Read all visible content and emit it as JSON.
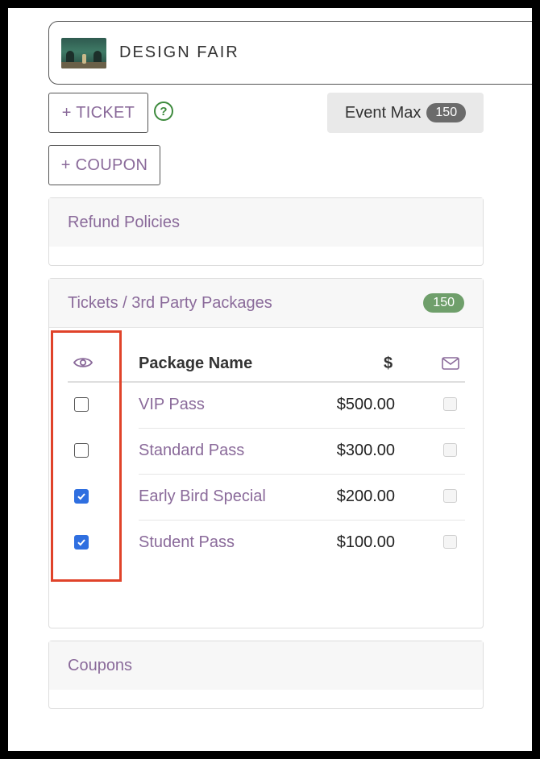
{
  "event": {
    "name": "DESIGN FAIR",
    "thumbnail_icon": "gallery-image"
  },
  "actions": {
    "add_ticket_label": "+ TICKET",
    "add_coupon_label": "+ COUPON",
    "help_label": "?"
  },
  "event_max": {
    "label": "Event Max",
    "value": "150"
  },
  "panels": {
    "refund": {
      "title": "Refund Policies"
    },
    "tickets": {
      "title": "Tickets / 3rd Party Packages",
      "count": "150",
      "columns": {
        "visibility_icon": "eye-icon",
        "name": "Package Name",
        "price": "$",
        "email_icon": "mail-icon"
      },
      "rows": [
        {
          "name": "VIP Pass",
          "price": "$500.00",
          "visible": false,
          "email": false
        },
        {
          "name": "Standard Pass",
          "price": "$300.00",
          "visible": false,
          "email": false
        },
        {
          "name": "Early Bird Special",
          "price": "$200.00",
          "visible": true,
          "email": false
        },
        {
          "name": "Student Pass",
          "price": "$100.00",
          "visible": true,
          "email": false
        }
      ]
    },
    "coupons": {
      "title": "Coupons"
    }
  },
  "colors": {
    "accent_text": "#8a6a9a",
    "count_badge": "#6f9f6b",
    "checkbox_checked": "#2f6fe0",
    "highlight": "#e0432a"
  }
}
